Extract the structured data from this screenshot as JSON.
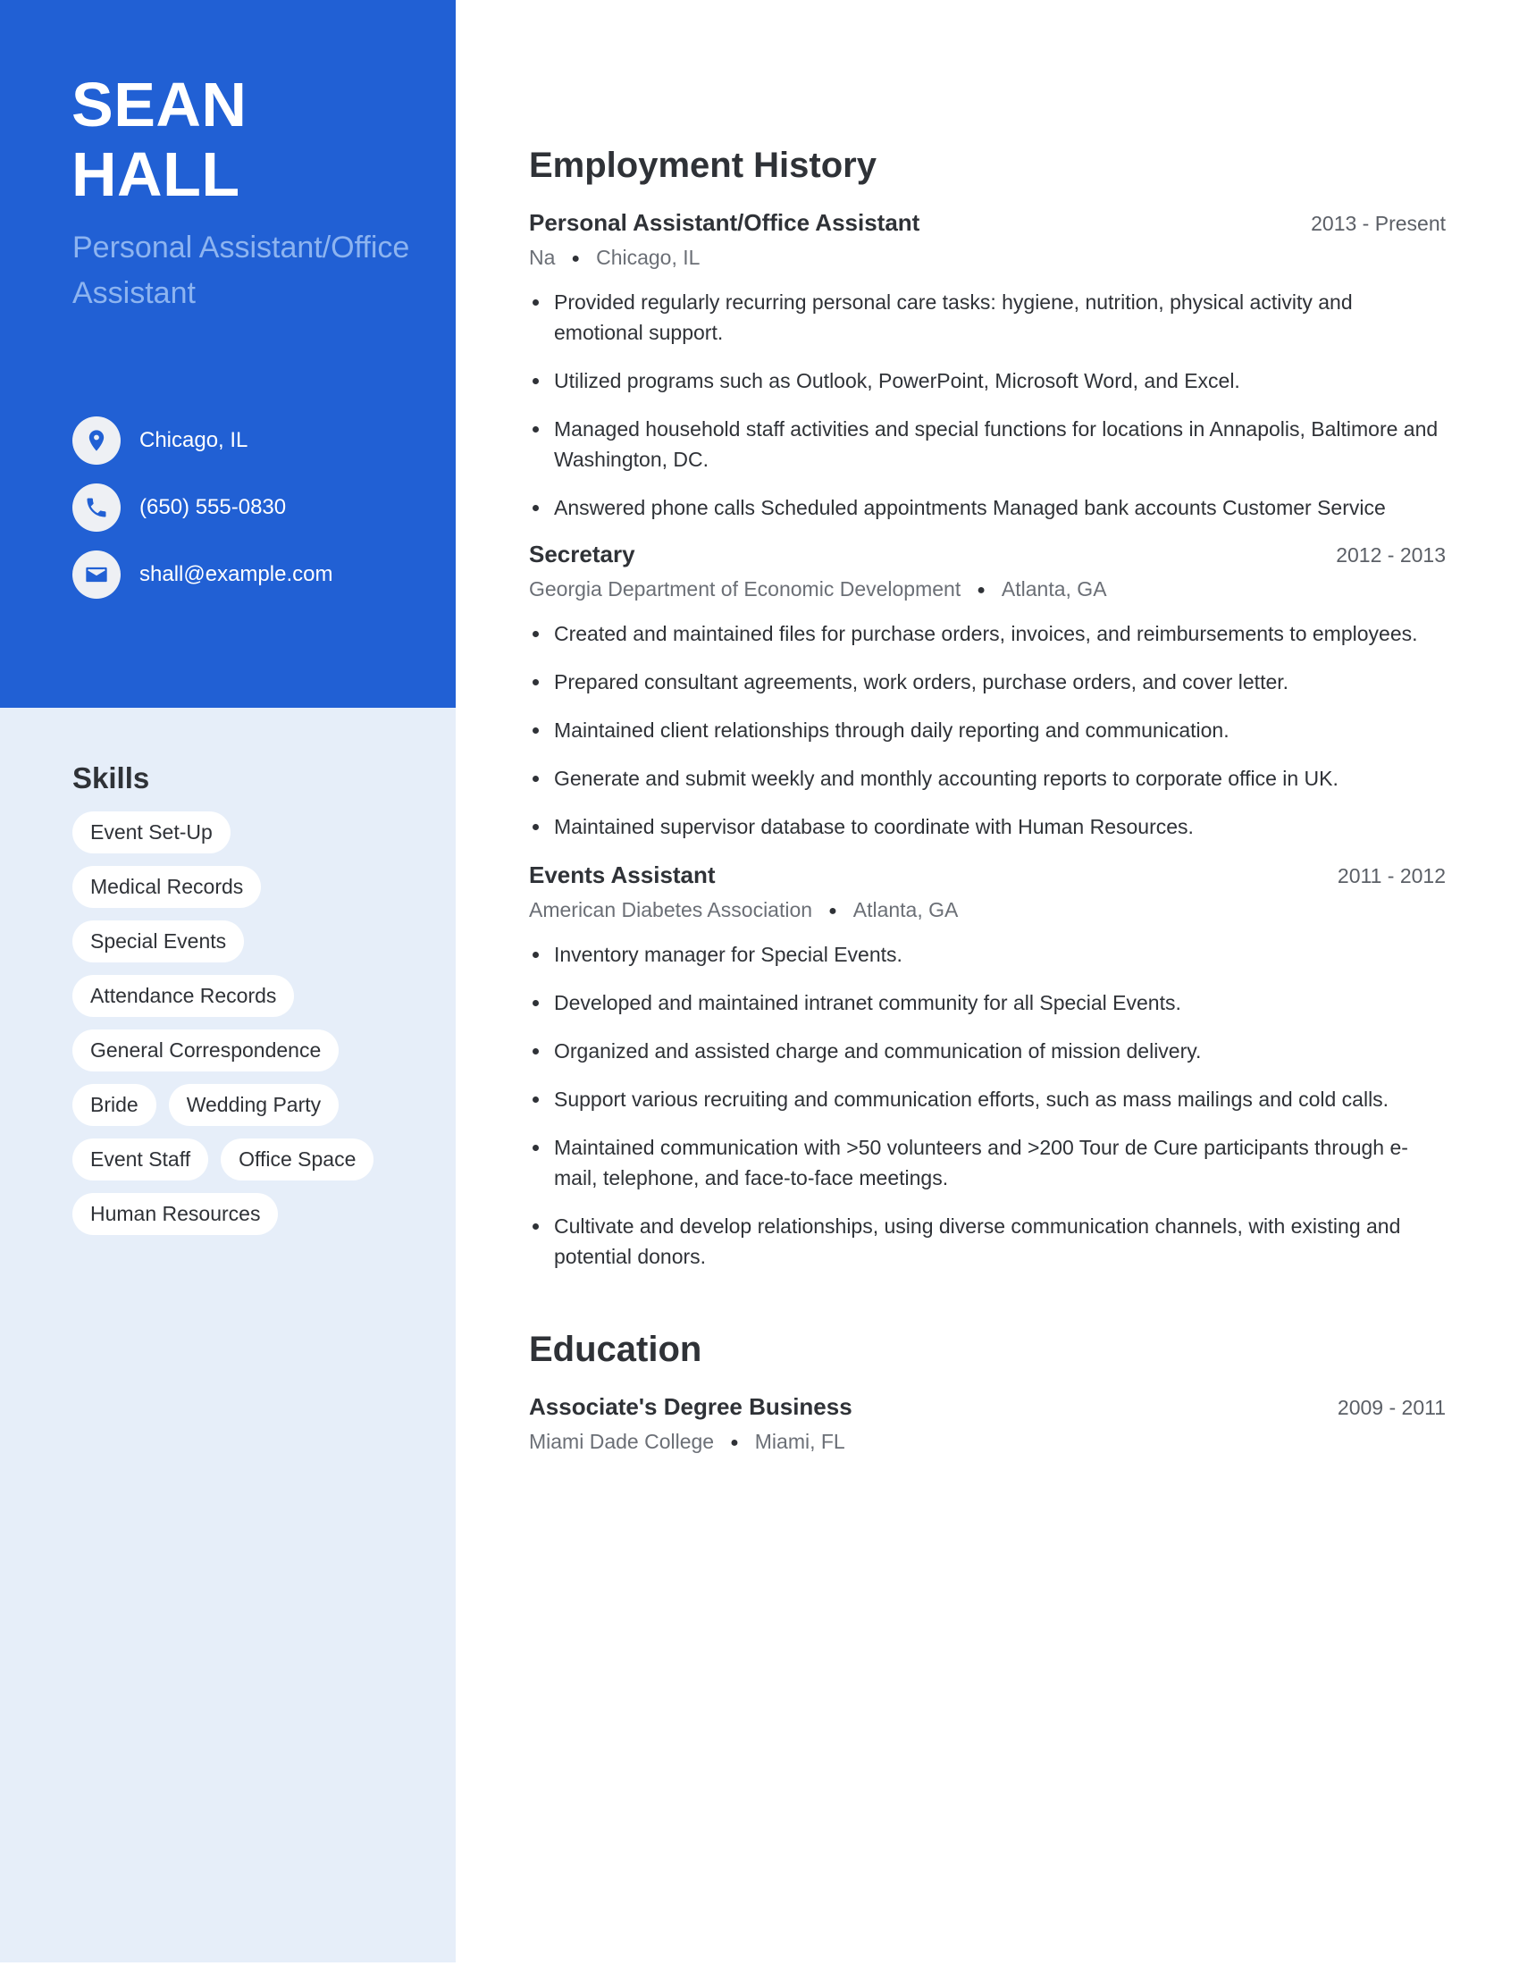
{
  "colors": {
    "accent": "#2160d4",
    "sidebar_light": "#e6eef9",
    "job_title_light": "#8db4f0",
    "text_dark": "#2f3237"
  },
  "profile": {
    "first_name": "SEAN",
    "last_name": "HALL",
    "title": "Personal Assistant/Office Assistant"
  },
  "contacts": [
    {
      "icon": "location-pin-icon",
      "text": "Chicago, IL"
    },
    {
      "icon": "phone-icon",
      "text": "(650) 555-0830"
    },
    {
      "icon": "envelope-icon",
      "text": "shall@example.com"
    }
  ],
  "skills": {
    "title": "Skills",
    "items": [
      "Event Set-Up",
      "Medical Records",
      "Special Events",
      "Attendance Records",
      "General Correspondence",
      "Bride",
      "Wedding Party",
      "Event Staff",
      "Office Space",
      "Human Resources"
    ]
  },
  "employment": {
    "title": "Employment History",
    "jobs": [
      {
        "position": "Personal Assistant/Office Assistant",
        "dates": "2013 - Present",
        "employer": "Na",
        "location": "Chicago, IL",
        "bullets": [
          "Provided regularly recurring personal care tasks: hygiene, nutrition, physical activity and emotional support.",
          "Utilized programs such as Outlook, PowerPoint, Microsoft Word, and Excel.",
          "Managed household staff activities and special functions for locations in Annapolis, Baltimore and Washington, DC.",
          "Answered phone calls Scheduled appointments Managed bank accounts Customer Service"
        ]
      },
      {
        "position": "Secretary",
        "dates": "2012 - 2013",
        "employer": "Georgia Department of Economic Development",
        "location": "Atlanta, GA",
        "bullets": [
          "Created and maintained files for purchase orders, invoices, and reimbursements to employees.",
          "Prepared consultant agreements, work orders, purchase orders, and cover letter.",
          "Maintained client relationships through daily reporting and communication.",
          "Generate and submit weekly and monthly accounting reports to corporate office in UK.",
          "Maintained supervisor database to coordinate with Human Resources."
        ]
      },
      {
        "position": "Events Assistant",
        "dates": "2011 - 2012",
        "employer": "American Diabetes Association",
        "location": "Atlanta, GA",
        "bullets": [
          "Inventory manager for Special Events.",
          "Developed and maintained intranet community for all Special Events.",
          "Organized and assisted charge and communication of mission delivery.",
          "Support various recruiting and communication efforts, such as mass mailings and cold calls.",
          "Maintained communication with >50 volunteers and >200 Tour de Cure participants through e-mail, telephone, and face-to-face meetings.",
          "Cultivate and develop relationships, using diverse communication channels, with existing and potential donors."
        ]
      }
    ]
  },
  "education": {
    "title": "Education",
    "entries": [
      {
        "degree": "Associate's Degree Business",
        "dates": "2009 - 2011",
        "school": "Miami Dade College",
        "location": "Miami, FL"
      }
    ]
  }
}
